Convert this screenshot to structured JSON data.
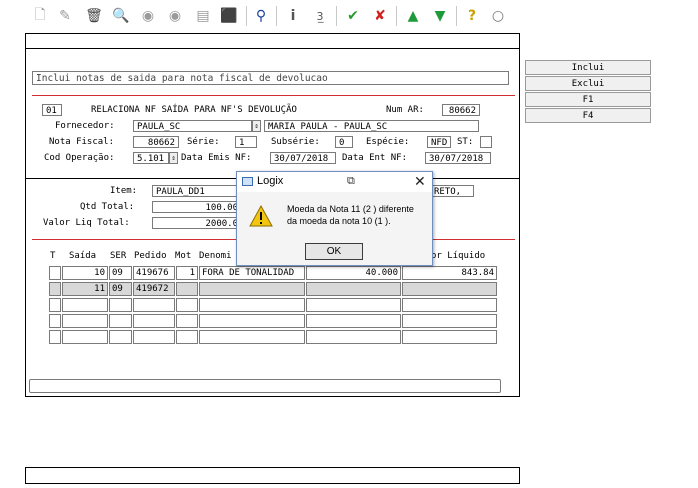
{
  "toolbar": {
    "icons": [
      "new-icon",
      "edit-icon",
      "delete-icon",
      "search-icon",
      "previous-icon",
      "next-icon",
      "print-icon",
      "export-icon",
      "binoculars-icon",
      "info-icon",
      "numbers-icon",
      "confirm-icon",
      "cancel-icon",
      "up-icon",
      "down-icon",
      "help-icon",
      "chat-icon"
    ]
  },
  "hint": "Inclui notas de saida para nota fiscal de devolucao",
  "header": {
    "code": "01",
    "title": "RELACIONA NF SAÍDA PARA NF'S DEVOLUÇÃO",
    "num_ar_label": "Num AR:",
    "num_ar_value": "80662",
    "fornecedor_label": "Fornecedor:",
    "fornecedor_code": "PAULA_SC",
    "fornecedor_name": "MARIA PAULA - PAULA_SC",
    "nota_label": "Nota Fiscal:",
    "nota_value": "80662",
    "serie_label": "Série:",
    "serie_value": "1",
    "subserie_label": "Subsérie:",
    "subserie_value": "0",
    "especie_label": "Espécie:",
    "especie_value": "NFD",
    "st_label": "ST:",
    "st_value": "",
    "cod_op_label": "Cod Operação:",
    "cod_op_value": "5.101",
    "data_emis_label": "Data Emis NF:",
    "data_emis_value": "30/07/2018",
    "data_ent_label": "Data Ent NF:",
    "data_ent_value": "30/07/2018"
  },
  "item": {
    "item_label": "Item:",
    "item_value": "PAULA_DD1",
    "item_desc": "RETO,",
    "qtd_label": "Qtd Total:",
    "qtd_value": "100.00",
    "valor_label": "Valor Liq Total:",
    "valor_value": "2000.0"
  },
  "grid": {
    "headers": [
      "T",
      "Saída",
      "SER",
      "Pedido",
      "Mot",
      "Denomi",
      "or Líquido"
    ],
    "rows": [
      {
        "t": "",
        "saida": "10",
        "ser": "09",
        "pedido": "419676",
        "mot": "1",
        "denom": "FORA DE TONALIDAD",
        "qtd": "40.000",
        "liquido": "843.84"
      },
      {
        "t": "",
        "saida": "11",
        "ser": "09",
        "pedido": "419672",
        "mot": "",
        "denom": "",
        "qtd": "",
        "liquido": ""
      }
    ]
  },
  "side_buttons": [
    "Inclui",
    "Exclui",
    "F1",
    "F4"
  ],
  "dialog": {
    "title": "Logix",
    "message_line1": "Moeda da Nota 11   (2 ) diferente",
    "message_line2": "da moeda da nota 10   (1 ).",
    "ok": "OK"
  }
}
